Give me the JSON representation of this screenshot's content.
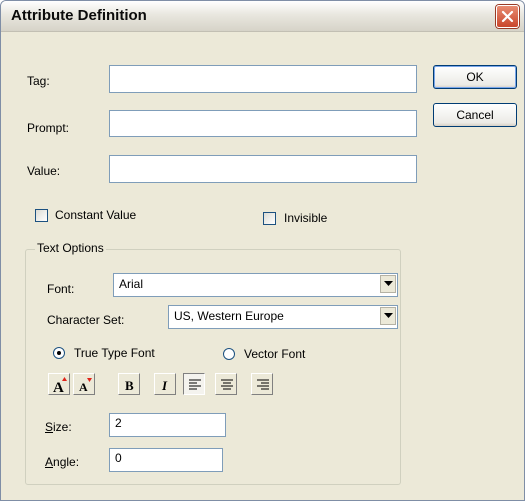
{
  "window": {
    "title": "Attribute Definition"
  },
  "fields": {
    "tag": {
      "label": "Tag:",
      "value": ""
    },
    "prompt": {
      "label": "Prompt:",
      "value": ""
    },
    "value": {
      "label": "Value:",
      "value": ""
    }
  },
  "buttons": {
    "ok": "OK",
    "cancel": "Cancel"
  },
  "checkboxes": {
    "constant": {
      "label": "Constant Value",
      "checked": false
    },
    "invisible": {
      "label": "Invisible",
      "checked": false
    }
  },
  "text_options": {
    "title": "Text Options",
    "font": {
      "label": "Font:",
      "value": "Arial"
    },
    "charset": {
      "label": "Character Set:",
      "value": "US, Western Europe"
    },
    "radios": {
      "truetype": "True Type Font",
      "vector": "Vector Font",
      "selected": "truetype"
    },
    "size": {
      "label_u": "S",
      "label_rest": "ize:",
      "value": "2"
    },
    "angle": {
      "label_u": "A",
      "label_rest": "ngle:",
      "value": "0"
    },
    "toolbar_icons": [
      "font-grow-icon",
      "font-shrink-icon",
      "bold-icon",
      "italic-icon",
      "align-left-icon",
      "align-center-icon",
      "align-right-icon"
    ]
  }
}
